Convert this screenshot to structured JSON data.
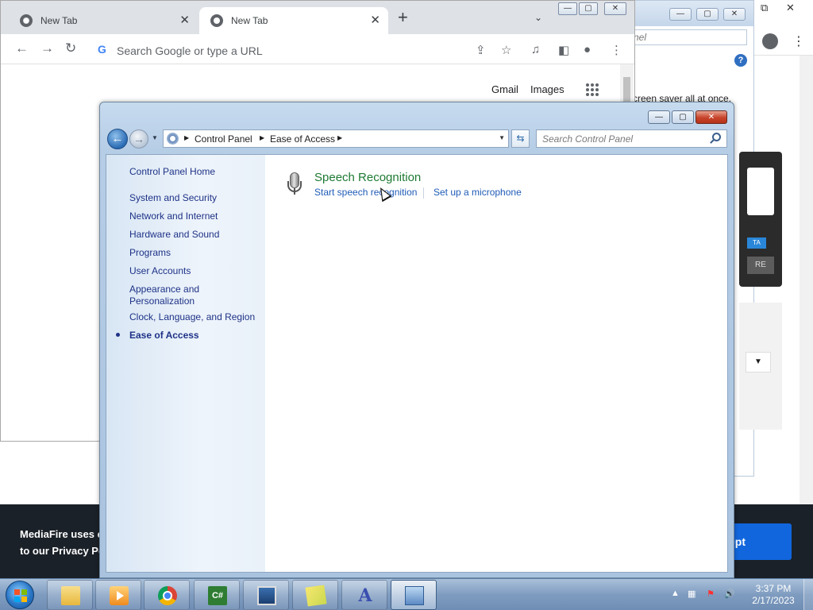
{
  "chrome": {
    "tabs": [
      {
        "label": "New Tab",
        "active": false
      },
      {
        "label": "New Tab",
        "active": true
      }
    ],
    "new_tab_symbol": "+",
    "omnibox_placeholder": "Search Google or type a URL",
    "ntp_links": {
      "gmail": "Gmail",
      "images": "Images"
    }
  },
  "background_window": {
    "search_fragment": "nel",
    "help_symbol": "?",
    "text_fragment": "creen saver all at once.",
    "badge_fragment": "TA",
    "button_fragment": "RE"
  },
  "cookie_banner": {
    "line1": "MediaFire uses c",
    "line2": "to our Privacy Po",
    "button_fragment": "ept"
  },
  "control_panel": {
    "breadcrumb": [
      "Control Panel",
      "Ease of Access"
    ],
    "search_placeholder": "Search Control Panel",
    "nav": {
      "home": "Control Panel Home",
      "items": [
        "System and Security",
        "Network and Internet",
        "Hardware and Sound",
        "Programs",
        "User Accounts",
        "Appearance and Personalization",
        "Clock, Language, and Region",
        "Ease of Access"
      ],
      "current": "Ease of Access"
    },
    "section": {
      "title": "Speech Recognition",
      "icon": "microphone-icon",
      "links": [
        "Start speech recognition",
        "Set up a microphone"
      ]
    }
  },
  "taskbar": {
    "apps": [
      "windows-explorer",
      "media-player",
      "google-chrome",
      "csharp-editor",
      "remote-desktop",
      "sticky-notes",
      "accessibility",
      "control-panel"
    ],
    "active_app": "control-panel",
    "clock": {
      "time": "3:37 PM",
      "date": "2/17/2023"
    }
  },
  "colors": {
    "cp_link": "#1f5bb7",
    "cp_section_title": "#1e7a33",
    "cookie_button": "#1166dd",
    "close_button": "#c7432a"
  }
}
